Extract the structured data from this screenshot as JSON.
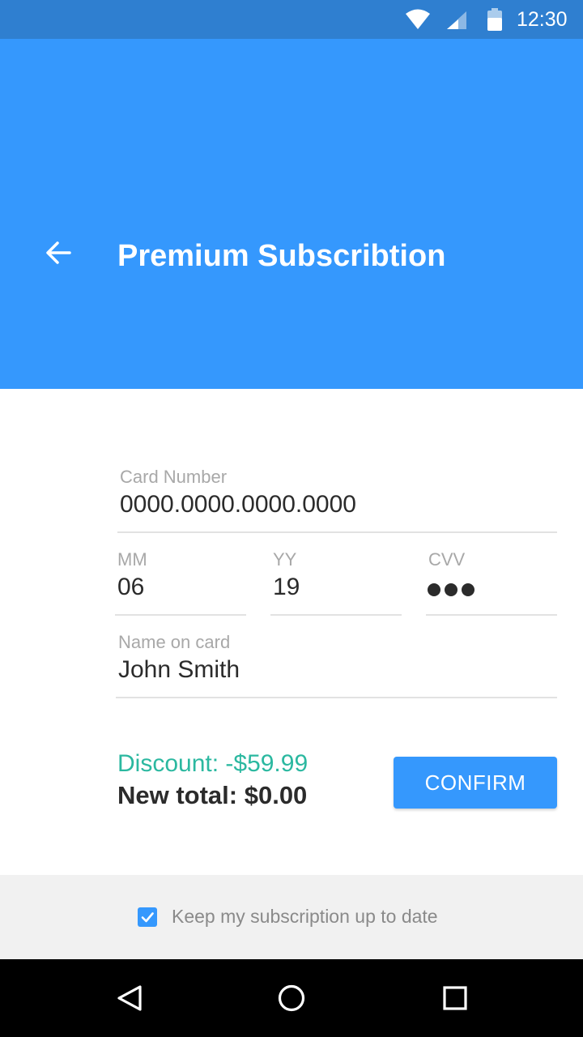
{
  "status_bar": {
    "time": "12:30",
    "icons": [
      "wifi-icon",
      "signal-icon",
      "battery-icon"
    ]
  },
  "header": {
    "back_icon": "arrow-left-icon",
    "title": "Premium Subscribtion"
  },
  "form": {
    "card_number": {
      "label": "Card Number",
      "value": "0000.0000.0000.0000"
    },
    "month": {
      "label": "MM",
      "value": "06"
    },
    "year": {
      "label": "YY",
      "value": "19"
    },
    "cvv": {
      "label": "CVV",
      "masked_length": 3
    },
    "name": {
      "label": "Name on card",
      "value": "John Smith"
    }
  },
  "summary": {
    "discount": "Discount: -$59.99",
    "total": "New total: $0.00",
    "confirm_label": "CONFIRM"
  },
  "footer": {
    "checkbox_checked": true,
    "checkbox_label": "Keep my subscription up to date"
  },
  "navigation": {
    "icons": [
      "back-triangle-icon",
      "home-circle-icon",
      "recents-square-icon"
    ]
  },
  "colors": {
    "primary": "#3598fd",
    "status_bar": "#2f7fd0",
    "discount": "#2bb8a0",
    "footer_bg": "#f1f1f1"
  }
}
